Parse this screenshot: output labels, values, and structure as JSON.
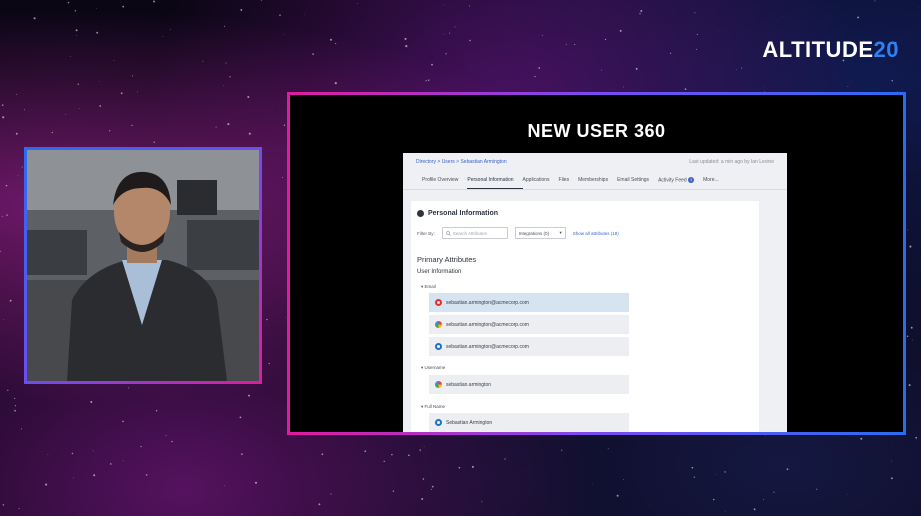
{
  "brand": {
    "text": "ALTITUDE",
    "num": "20"
  },
  "screen": {
    "title": "NEW USER 360"
  },
  "app": {
    "breadcrumb": "Directory > Users > Sebastian Armington",
    "last_updated": "Last updated: a min ago by Ian Levine",
    "tabs": [
      {
        "label": "Profile Overview",
        "active": false
      },
      {
        "label": "Personal Information",
        "active": true
      },
      {
        "label": "Applications",
        "active": false
      },
      {
        "label": "Files",
        "active": false
      },
      {
        "label": "Memberships",
        "active": false
      },
      {
        "label": "Email Settings",
        "active": false
      },
      {
        "label": "Activity Feed",
        "active": false
      },
      {
        "label": "More...",
        "active": false
      }
    ],
    "activity_badge": "1",
    "card": {
      "heading": "Personal Information",
      "filter_label": "Filter By:",
      "search_placeholder": "Search Attributes",
      "select_value": "Integrations (0)",
      "show_all": "Show all attributes (18)",
      "primary_attributes": "Primary Attributes",
      "user_information": "User Information",
      "email_label": "Email",
      "emails": [
        {
          "icon": "okta-icon",
          "value": "sebastian.armington@acmecorp.com"
        },
        {
          "icon": "google-icon",
          "value": "sebastian.armington@acmecorp.com"
        },
        {
          "icon": "azure-icon",
          "value": "sebastian.armington@acmecorp.com"
        }
      ],
      "username_label": "Username",
      "username": {
        "icon": "google-icon",
        "value": "sebastian.armington"
      },
      "fullname_label": "Full Name",
      "fullname": {
        "icon": "azure-icon",
        "value": "Sebastian Armington"
      }
    }
  }
}
